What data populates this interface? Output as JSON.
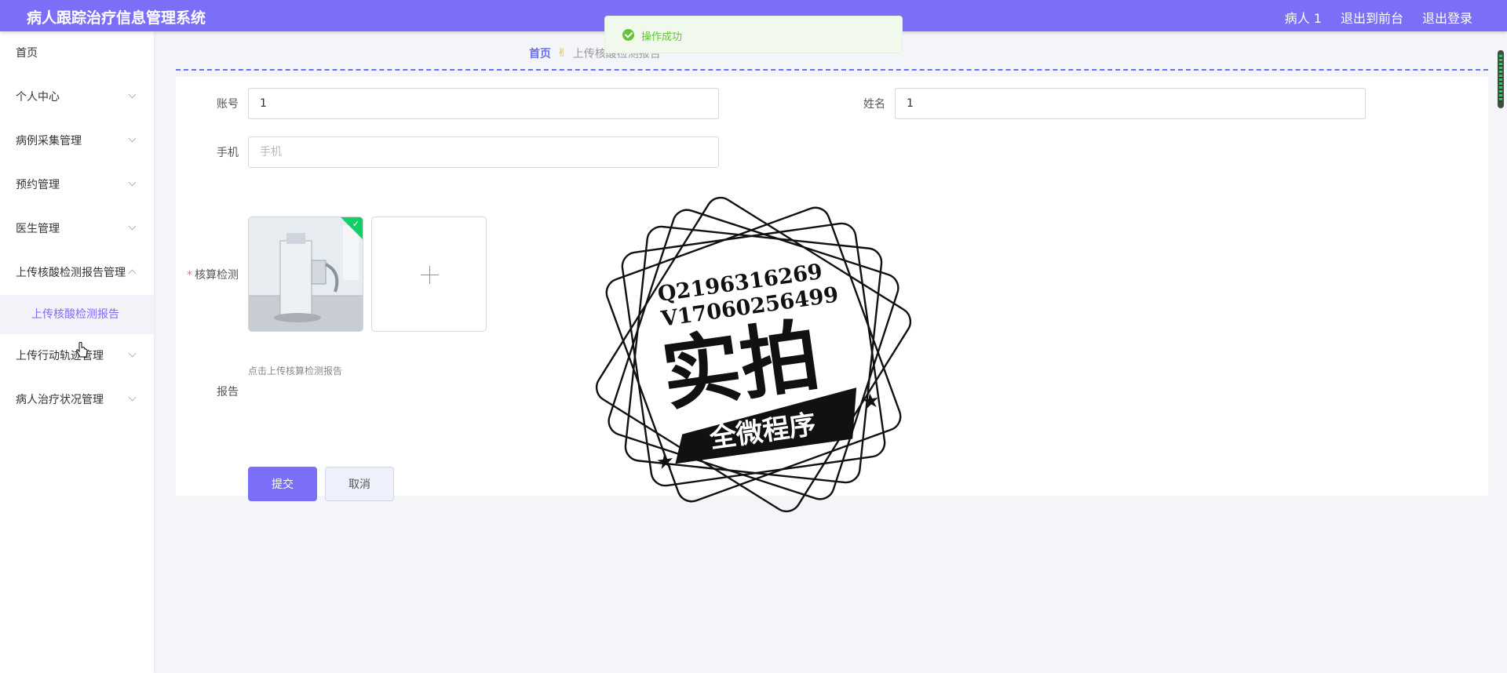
{
  "header": {
    "title": "病人跟踪治疗信息管理系统",
    "user": "病人 1",
    "back_to_front": "退出到前台",
    "logout": "退出登录"
  },
  "sidebar": {
    "items": [
      {
        "label": "首页"
      },
      {
        "label": "个人中心"
      },
      {
        "label": "病例采集管理"
      },
      {
        "label": "预约管理"
      },
      {
        "label": "医生管理"
      },
      {
        "label": "上传核酸检测报告管理",
        "expanded": true,
        "children": [
          {
            "label": "上传核酸检测报告",
            "active": true
          }
        ]
      },
      {
        "label": "上传行动轨迹管理"
      },
      {
        "label": "病人治疗状况管理"
      }
    ]
  },
  "breadcrumb": {
    "home": "首页",
    "current": "上传核酸检测报告"
  },
  "form": {
    "account_label": "账号",
    "account_value": "1",
    "name_label": "姓名",
    "name_value": "1",
    "phone_label": "手机",
    "phone_placeholder": "手机",
    "test_label": "核算检测",
    "upload_tip": "点击上传核算检测报告",
    "report_label": "报告",
    "submit_label": "提交",
    "cancel_label": "取消"
  },
  "toast": {
    "message": "操作成功",
    "color": "#67c23a"
  },
  "watermark": {
    "line1": "Q2196316269",
    "line2": "V17060256499",
    "big": "实拍",
    "banner": "全微程序"
  },
  "colors": {
    "accent": "#7b6ff7",
    "success": "#13ce66"
  }
}
